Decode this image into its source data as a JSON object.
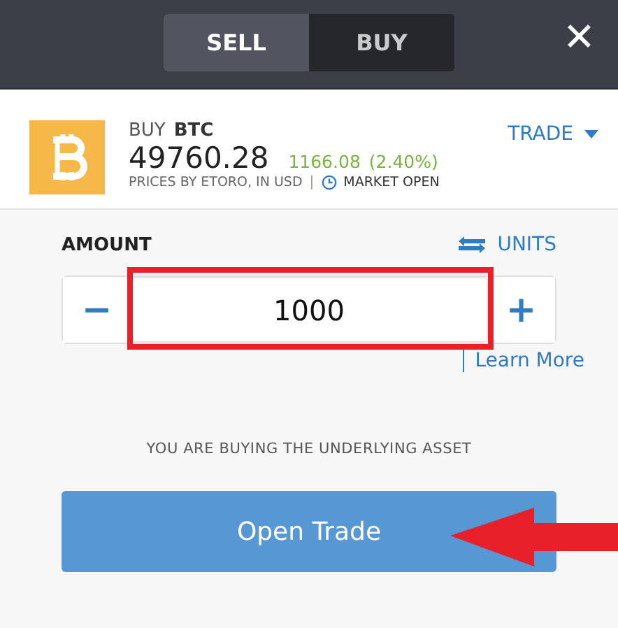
{
  "tabs": [
    {
      "label": "SELL",
      "selected": true
    },
    {
      "label": "BUY",
      "selected": false
    }
  ],
  "close": "✕",
  "instrument": {
    "action": "BUY",
    "symbol": "BTC",
    "price": "49760.28",
    "change": "1166.08",
    "change_pct": "(2.40%)",
    "source": "PRICES BY ETORO, IN USD",
    "separator": "|",
    "market_status": "MARKET OPEN",
    "menu": "TRADE"
  },
  "amount": {
    "label": "AMOUNT",
    "units": "UNITS",
    "minus": "−",
    "value": "1000",
    "plus": "+",
    "learn_more": "Learn More"
  },
  "notice": "YOU ARE BUYING THE UNDERLYING ASSET",
  "submit": "Open Trade"
}
